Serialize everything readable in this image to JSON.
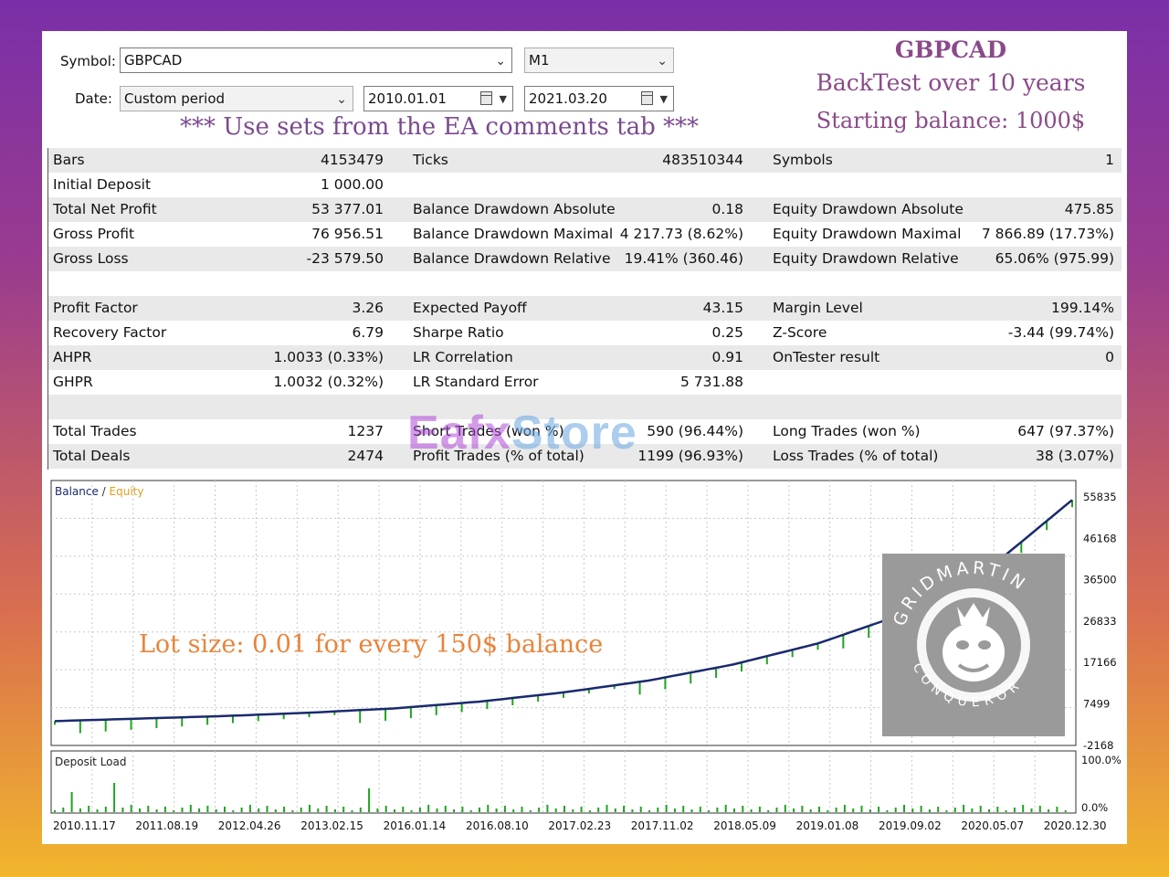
{
  "form": {
    "symbol_label": "Symbol:",
    "symbol_value": "GBPCAD",
    "timeframe_value": "M1",
    "date_label": "Date:",
    "period_value": "Custom period",
    "date_from": "2010.01.01",
    "date_to": "2021.03.20"
  },
  "notes": {
    "sets_note": "*** Use sets from the EA comments tab ***",
    "title_symbol": "GBPCAD",
    "title_backtest": "BackTest over 10 years",
    "title_balance": "Starting balance: 1000$",
    "lot_note": "Lot size: 0.01 for every 150$ balance"
  },
  "watermark": {
    "part1": "Eafx",
    "part2": "Store"
  },
  "badge": {
    "top_text": "GRIDMARTIN",
    "bottom_text": "CONQUEROR"
  },
  "stats": [
    [
      {
        "k": "Bars",
        "v": "4153479"
      },
      {
        "k": "Ticks",
        "v": "483510344"
      },
      {
        "k": "Symbols",
        "v": "1"
      }
    ],
    [
      {
        "k": "Initial Deposit",
        "v": "1 000.00"
      },
      {
        "k": "",
        "v": ""
      },
      {
        "k": "",
        "v": ""
      }
    ],
    [
      {
        "k": "Total Net Profit",
        "v": "53 377.01"
      },
      {
        "k": "Balance Drawdown Absolute",
        "v": "0.18"
      },
      {
        "k": "Equity Drawdown Absolute",
        "v": "475.85"
      }
    ],
    [
      {
        "k": "Gross Profit",
        "v": "76 956.51"
      },
      {
        "k": "Balance Drawdown Maximal",
        "v": "4 217.73 (8.62%)"
      },
      {
        "k": "Equity Drawdown Maximal",
        "v": "7 866.89 (17.73%)"
      }
    ],
    [
      {
        "k": "Gross Loss",
        "v": "-23 579.50"
      },
      {
        "k": "Balance Drawdown Relative",
        "v": "19.41% (360.46)"
      },
      {
        "k": "Equity Drawdown Relative",
        "v": "65.06% (975.99)"
      }
    ],
    [
      {
        "k": "",
        "v": ""
      },
      {
        "k": "",
        "v": ""
      },
      {
        "k": "",
        "v": ""
      }
    ],
    [
      {
        "k": "Profit Factor",
        "v": "3.26"
      },
      {
        "k": "Expected Payoff",
        "v": "43.15"
      },
      {
        "k": "Margin Level",
        "v": "199.14%"
      }
    ],
    [
      {
        "k": "Recovery Factor",
        "v": "6.79"
      },
      {
        "k": "Sharpe Ratio",
        "v": "0.25"
      },
      {
        "k": "Z-Score",
        "v": "-3.44 (99.74%)"
      }
    ],
    [
      {
        "k": "AHPR",
        "v": "1.0033 (0.33%)"
      },
      {
        "k": "LR Correlation",
        "v": "0.91"
      },
      {
        "k": "OnTester result",
        "v": "0"
      }
    ],
    [
      {
        "k": "GHPR",
        "v": "1.0032 (0.32%)"
      },
      {
        "k": "LR Standard Error",
        "v": "5 731.88"
      },
      {
        "k": "",
        "v": ""
      }
    ],
    [
      {
        "k": "",
        "v": ""
      },
      {
        "k": "",
        "v": ""
      },
      {
        "k": "",
        "v": ""
      }
    ],
    [
      {
        "k": "Total Trades",
        "v": "1237"
      },
      {
        "k": "Short Trades (won %)",
        "v": "590 (96.44%)"
      },
      {
        "k": "Long Trades (won %)",
        "v": "647 (97.37%)"
      }
    ],
    [
      {
        "k": "Total Deals",
        "v": "2474"
      },
      {
        "k": "Profit Trades (% of total)",
        "v": "1199 (96.93%)"
      },
      {
        "k": "Loss Trades (% of total)",
        "v": "38 (3.07%)"
      }
    ]
  ],
  "chart_data": {
    "type": "line",
    "legend_balance": "Balance",
    "legend_sep": " / ",
    "legend_equity": "Equity",
    "colors": {
      "balance": "#1a2a6e",
      "equity": "#1fa31f"
    },
    "y_ticks": [
      "55835",
      "46168",
      "36500",
      "26833",
      "17166",
      "7499",
      "-2168"
    ],
    "ylim": [
      -2168,
      55835
    ],
    "x_ticks": [
      "2010.11.17",
      "2011.08.19",
      "2012.04.26",
      "2013.02.15",
      "2016.01.14",
      "2016.08.10",
      "2017.02.23",
      "2017.11.02",
      "2018.05.09",
      "2019.01.08",
      "2019.09.02",
      "2020.05.07",
      "2020.12.30"
    ],
    "series": [
      {
        "name": "Balance",
        "x": [
          0,
          1,
          2,
          3,
          4,
          5,
          6,
          7,
          8,
          9,
          10,
          11,
          12
        ],
        "values": [
          1000,
          1600,
          2200,
          3000,
          4000,
          5600,
          7800,
          10600,
          14400,
          19400,
          26300,
          36800,
          53400
        ]
      }
    ],
    "deposit_load": {
      "title": "Deposit Load",
      "y_ticks": [
        "100.0%",
        "0.0%"
      ]
    }
  }
}
